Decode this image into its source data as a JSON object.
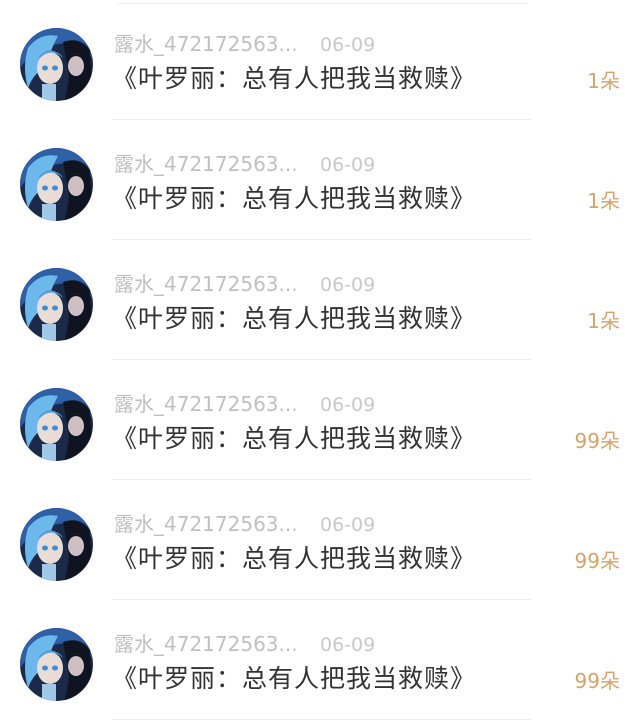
{
  "items": [
    {
      "username": "露水_472172563...",
      "date": "06-09",
      "title": "《叶罗丽：总有人把我当救赎》",
      "count": "1朵"
    },
    {
      "username": "露水_472172563...",
      "date": "06-09",
      "title": "《叶罗丽：总有人把我当救赎》",
      "count": "1朵"
    },
    {
      "username": "露水_472172563...",
      "date": "06-09",
      "title": "《叶罗丽：总有人把我当救赎》",
      "count": "1朵"
    },
    {
      "username": "露水_472172563...",
      "date": "06-09",
      "title": "《叶罗丽：总有人把我当救赎》",
      "count": "99朵"
    },
    {
      "username": "露水_472172563...",
      "date": "06-09",
      "title": "《叶罗丽：总有人把我当救赎》",
      "count": "99朵"
    },
    {
      "username": "露水_472172563...",
      "date": "06-09",
      "title": "《叶罗丽：总有人把我当救赎》",
      "count": "99朵"
    }
  ],
  "colors": {
    "count_accent": "#d6a36a",
    "meta_text": "#c2c2c2",
    "title_text": "#333333"
  }
}
